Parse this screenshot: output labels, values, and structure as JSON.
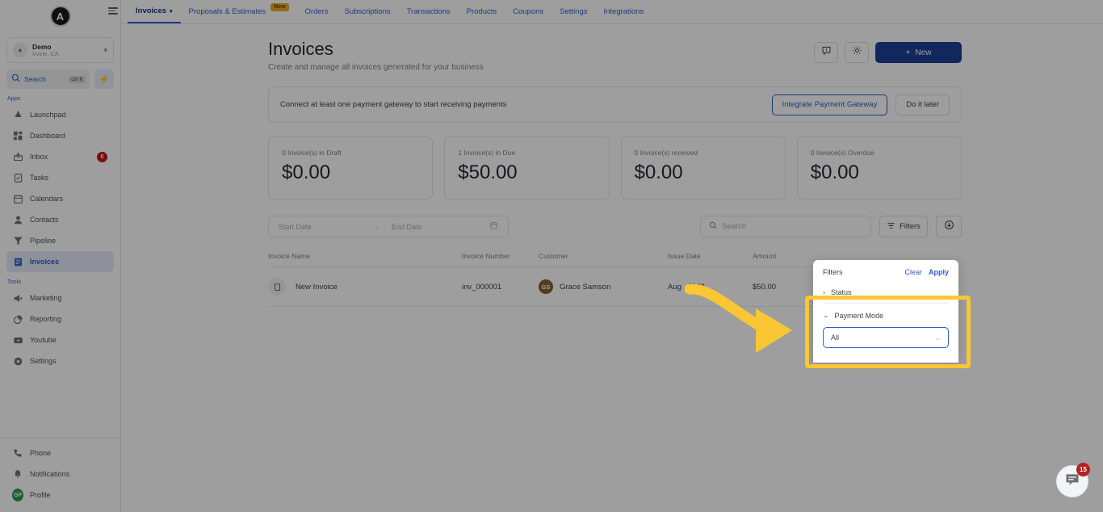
{
  "app": {
    "logo_letter": "A",
    "workspace": {
      "name": "Demo",
      "location": "Irvine, CA"
    },
    "search": {
      "label": "Search",
      "shortcut": "ctrl K"
    }
  },
  "sidebar": {
    "sections": [
      {
        "title": "Apps",
        "items": [
          {
            "label": "Launchpad",
            "icon": "rocket-icon",
            "badge": null,
            "active": false
          },
          {
            "label": "Dashboard",
            "icon": "grid-icon",
            "badge": null,
            "active": false
          },
          {
            "label": "Inbox",
            "icon": "inbox-icon",
            "badge": "0",
            "active": false
          },
          {
            "label": "Tasks",
            "icon": "clipboard-icon",
            "badge": null,
            "active": false
          },
          {
            "label": "Calendars",
            "icon": "calendar-icon",
            "badge": null,
            "active": false
          },
          {
            "label": "Contacts",
            "icon": "person-icon",
            "badge": null,
            "active": false
          },
          {
            "label": "Pipeline",
            "icon": "funnel-icon",
            "badge": null,
            "active": false
          },
          {
            "label": "Invoices",
            "icon": "invoice-icon",
            "badge": null,
            "active": true
          }
        ]
      },
      {
        "title": "Tools",
        "items": [
          {
            "label": "Marketing",
            "icon": "megaphone-icon",
            "badge": null,
            "active": false
          },
          {
            "label": "Reporting",
            "icon": "piechart-icon",
            "badge": null,
            "active": false
          },
          {
            "label": "Youtube",
            "icon": "youtube-icon",
            "badge": null,
            "active": false
          },
          {
            "label": "Settings",
            "icon": "gear-icon",
            "badge": null,
            "active": false
          }
        ]
      }
    ],
    "bottom": [
      {
        "label": "Phone",
        "icon": "phone-icon"
      },
      {
        "label": "Notifications",
        "icon": "bell-icon"
      },
      {
        "label": "Profile",
        "icon": "avatar-icon",
        "initials": "GP"
      }
    ]
  },
  "topnav": {
    "tabs": [
      {
        "label": "Invoices",
        "active": true,
        "has_chevron": true,
        "badge": null
      },
      {
        "label": "Proposals & Estimates",
        "active": false,
        "has_chevron": false,
        "badge": "New"
      },
      {
        "label": "Orders",
        "active": false,
        "has_chevron": false,
        "badge": null
      },
      {
        "label": "Subscriptions",
        "active": false,
        "has_chevron": false,
        "badge": null
      },
      {
        "label": "Transactions",
        "active": false,
        "has_chevron": false,
        "badge": null
      },
      {
        "label": "Products",
        "active": false,
        "has_chevron": false,
        "badge": null
      },
      {
        "label": "Coupons",
        "active": false,
        "has_chevron": false,
        "badge": null
      },
      {
        "label": "Settings",
        "active": false,
        "has_chevron": false,
        "badge": null
      },
      {
        "label": "Integrations",
        "active": false,
        "has_chevron": false,
        "badge": null
      }
    ]
  },
  "header": {
    "title": "Invoices",
    "subtitle": "Create and manage all invoices generated for your business",
    "new_button": "New",
    "new_button_plus": "+"
  },
  "gateway_banner": {
    "message": "Connect at least one payment gateway to start receiving payments",
    "primary_label": "Integrate Payment Gateway",
    "secondary_label": "Do it later"
  },
  "stats": [
    {
      "label": "0 Invoice(s) in Draft",
      "value": "$0.00"
    },
    {
      "label": "1 Invoice(s) in Due",
      "value": "$50.00"
    },
    {
      "label": "0 Invoice(s) received",
      "value": "$0.00"
    },
    {
      "label": "0 Invoice(s) Overdue",
      "value": "$0.00"
    }
  ],
  "toolbar": {
    "start_date_placeholder": "Start Date",
    "range_arrow": "→",
    "end_date_placeholder": "End Date",
    "search_placeholder": "Search",
    "filters_label": "Filters"
  },
  "table": {
    "columns": [
      "Invoice Name",
      "Invoice Number",
      "Customer",
      "Issue Date",
      "Amount"
    ],
    "rows": [
      {
        "name": "New Invoice",
        "number": "inv_000001",
        "customer": "Grace Samson",
        "customer_initials": "GS",
        "issue_date": "Aug  , 2023",
        "amount": "$50.00"
      }
    ]
  },
  "filters_panel": {
    "title": "Filters",
    "clear_label": "Clear",
    "apply_label": "Apply",
    "status_label": "Status",
    "payment_mode_label": "Payment Mode",
    "payment_mode_value": "All"
  },
  "chat": {
    "badge_count": "15"
  },
  "colors": {
    "accent_blue": "#2f5fc4",
    "primary_button": "#1e3f96",
    "highlight_yellow": "#fbc634",
    "badge_red": "#c91616",
    "avatar_green": "#2c9c4e",
    "customer_avatar": "#8a6132",
    "new_badge": "#f0ad1f"
  }
}
